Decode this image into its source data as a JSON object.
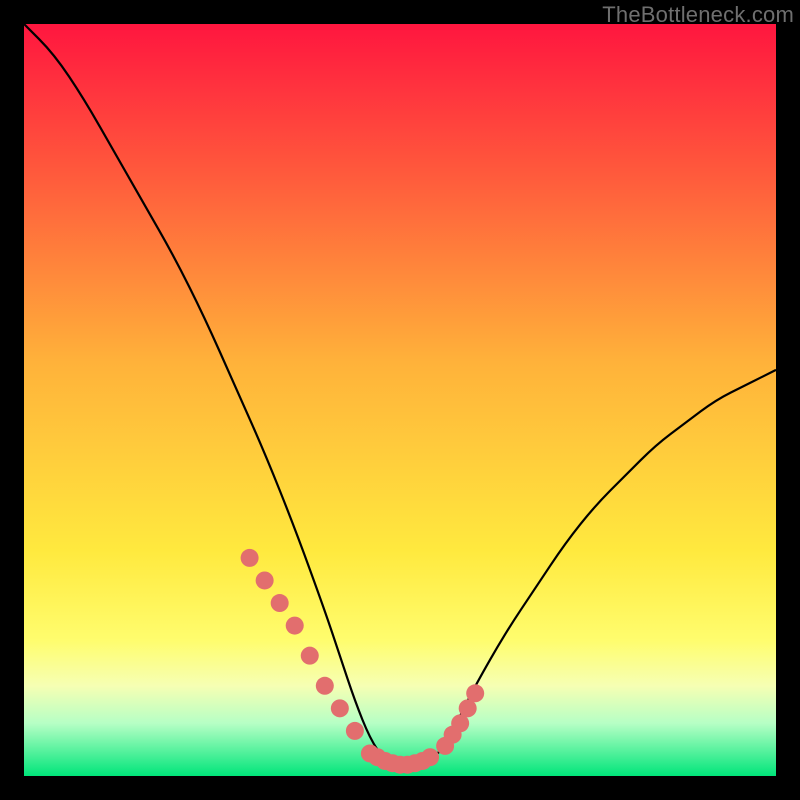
{
  "watermark": "TheBottleneck.com",
  "chart_data": {
    "type": "line",
    "title": "",
    "xlabel": "",
    "ylabel": "",
    "xlim": [
      0,
      100
    ],
    "ylim": [
      0,
      100
    ],
    "grid": false,
    "legend": false,
    "annotations": [],
    "background_gradient_stops": [
      {
        "offset": 0.0,
        "color": "#ff163f"
      },
      {
        "offset": 0.2,
        "color": "#ff5a3c"
      },
      {
        "offset": 0.45,
        "color": "#ffb23a"
      },
      {
        "offset": 0.7,
        "color": "#ffe93e"
      },
      {
        "offset": 0.82,
        "color": "#fffd6e"
      },
      {
        "offset": 0.88,
        "color": "#f6ffb3"
      },
      {
        "offset": 0.93,
        "color": "#b6ffc5"
      },
      {
        "offset": 1.0,
        "color": "#00e57a"
      }
    ],
    "series": [
      {
        "name": "bottleneck-curve",
        "stroke": "#000000",
        "stroke_width": 2.2,
        "x": [
          0,
          4,
          8,
          12,
          16,
          20,
          24,
          28,
          32,
          36,
          40,
          42,
          44,
          46,
          48,
          50,
          52,
          54,
          56,
          58,
          60,
          64,
          68,
          72,
          76,
          80,
          84,
          88,
          92,
          96,
          100
        ],
        "values": [
          100,
          96,
          90,
          83,
          76,
          69,
          61,
          52,
          43,
          33,
          22,
          16,
          10,
          5,
          2,
          1,
          1,
          2,
          4,
          8,
          12,
          19,
          25,
          31,
          36,
          40,
          44,
          47,
          50,
          52,
          54
        ]
      }
    ],
    "markers": {
      "name": "highlight-dots",
      "color": "#e26e6e",
      "radius": 9,
      "x": [
        30,
        32,
        34,
        36,
        38,
        40,
        42,
        44,
        46,
        47,
        48,
        49,
        50,
        51,
        52,
        53,
        54,
        56,
        57,
        58,
        59,
        60
      ],
      "values": [
        29,
        26,
        23,
        20,
        16,
        12,
        9,
        6,
        3,
        2.5,
        2,
        1.7,
        1.5,
        1.5,
        1.7,
        2,
        2.5,
        4,
        5.5,
        7,
        9,
        11
      ]
    }
  }
}
